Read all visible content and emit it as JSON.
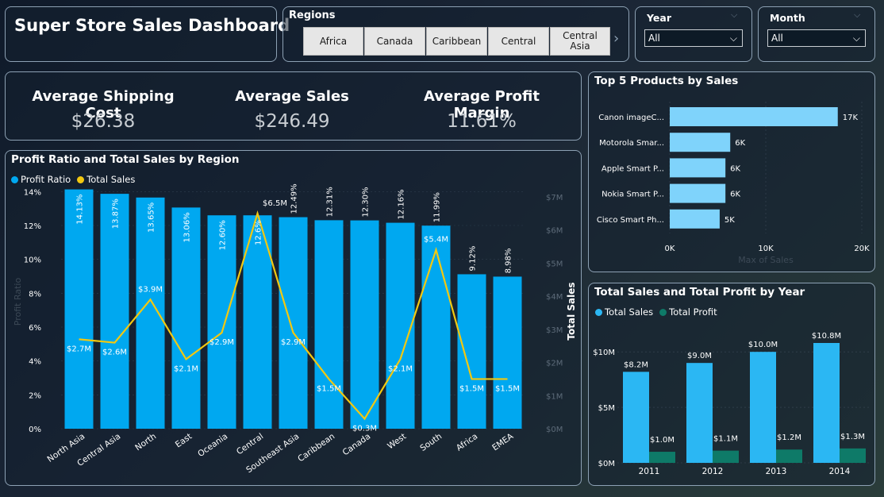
{
  "title": "Super Store Sales Dashboard",
  "regions": {
    "label": "Regions",
    "tiles": [
      "Africa",
      "Canada",
      "Caribbean",
      "Central",
      "Central Asia"
    ],
    "next_icon": "chevron-right-icon"
  },
  "filters": {
    "year": {
      "label": "Year",
      "value": "All"
    },
    "month": {
      "label": "Month",
      "value": "All"
    }
  },
  "kpis": [
    {
      "label": "Average Shipping Cost",
      "value": "$26.38"
    },
    {
      "label": "Average Sales",
      "value": "$246.49"
    },
    {
      "label": "Average Profit Margin",
      "value": "11.61%"
    }
  ],
  "colors": {
    "bar": "#00a8f0",
    "line": "#f2c811",
    "light_bar": "#7fd3fb",
    "total_sales": "#2bb7f3",
    "total_profit": "#0e7a68"
  },
  "chart_data": [
    {
      "type": "bar",
      "title": "Profit Ratio and Total Sales by Region",
      "categories": [
        "North Asia",
        "Central Asia",
        "North",
        "East",
        "Oceania",
        "Central",
        "Southeast Asia",
        "Caribbean",
        "Canada",
        "West",
        "South",
        "Africa",
        "EMEA"
      ],
      "series": [
        {
          "name": "Profit Ratio",
          "type": "bar",
          "axis": "left",
          "values": [
            14.13,
            13.87,
            13.65,
            13.06,
            12.6,
            12.6,
            12.49,
            12.31,
            12.3,
            12.16,
            11.99,
            9.12,
            8.98
          ],
          "labels": [
            "14.13%",
            "13.87%",
            "13.65%",
            "13.06%",
            "12.60%",
            "12.6%",
            "12.49%",
            "12.31%",
            "12.30%",
            "12.16%",
            "11.99%",
            "9.12%",
            "8.98%"
          ]
        },
        {
          "name": "Total Sales",
          "type": "line",
          "axis": "right",
          "values": [
            2.7,
            2.6,
            3.9,
            2.1,
            2.9,
            6.5,
            2.9,
            1.5,
            0.3,
            2.1,
            5.4,
            1.5,
            1.5
          ],
          "labels": [
            "$2.7M",
            "$2.6M",
            "$3.9M",
            "$2.1M",
            "$2.9M",
            "$6.5M",
            "$2.9M",
            "$1.5M",
            "$0.3M",
            "$2.1M",
            "$5.4M",
            "$1.5M",
            "$1.5M"
          ]
        }
      ],
      "ylabel": "Profit Ratio",
      "y2label": "Total Sales",
      "ylim": [
        0,
        15
      ],
      "y2lim": [
        0,
        7
      ],
      "yticks": [
        "0%",
        "2%",
        "4%",
        "6%",
        "8%",
        "10%",
        "12%",
        "14%"
      ],
      "y2ticks": [
        "$0M",
        "$1M",
        "$2M",
        "$3M",
        "$4M",
        "$5M",
        "$6M",
        "$7M"
      ],
      "legend": "top-left"
    },
    {
      "type": "bar",
      "title": "Top 5 Products by Sales",
      "orientation": "horizontal",
      "categories": [
        "Canon imageC...",
        "Motorola Smar...",
        "Apple Smart P...",
        "Nokia Smart P...",
        "Cisco Smart Ph..."
      ],
      "values": [
        17.5,
        6.3,
        5.8,
        5.8,
        5.2
      ],
      "labels": [
        "17K",
        "6K",
        "6K",
        "6K",
        "5K"
      ],
      "xlabel": "Max of Sales",
      "xticks": [
        "0K",
        "10K",
        "20K"
      ],
      "xlim": [
        0,
        20
      ]
    },
    {
      "type": "bar",
      "title": "Total Sales and Total Profit by Year",
      "categories": [
        "2011",
        "2012",
        "2013",
        "2014"
      ],
      "series": [
        {
          "name": "Total Sales",
          "values": [
            8.2,
            9.0,
            10.0,
            10.8
          ],
          "labels": [
            "$8.2M",
            "$9.0M",
            "$10.0M",
            "$10.8M"
          ]
        },
        {
          "name": "Total Profit",
          "values": [
            1.0,
            1.1,
            1.2,
            1.3
          ],
          "labels": [
            "$1.0M",
            "$1.1M",
            "$1.2M",
            "$1.3M"
          ]
        }
      ],
      "yticks": [
        "$0M",
        "$5M",
        "$10M"
      ],
      "ylim": [
        0,
        10.8
      ],
      "legend": "top-left"
    }
  ]
}
